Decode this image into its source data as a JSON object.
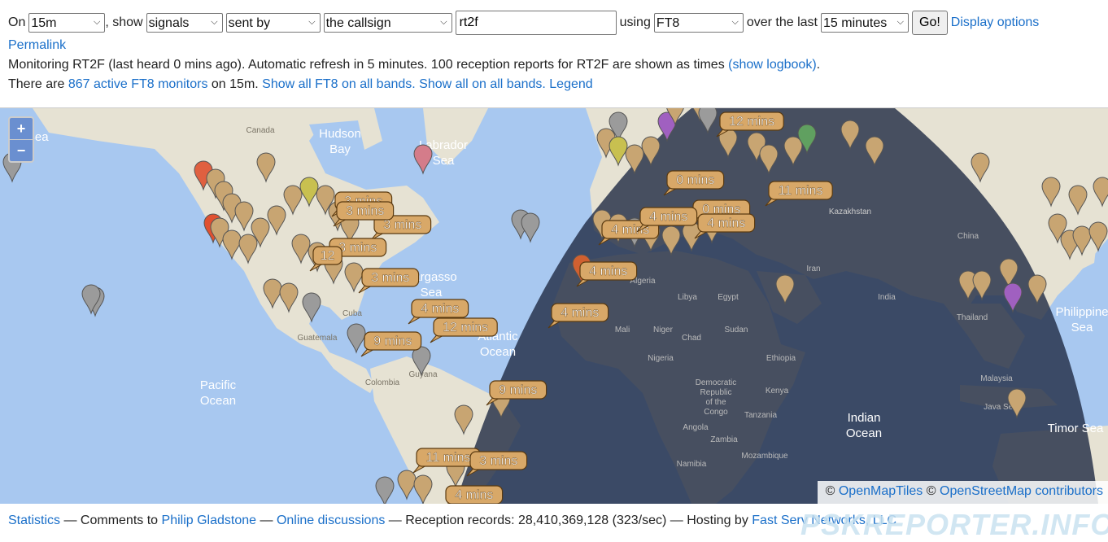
{
  "controls": {
    "on_label": "On",
    "band": "15m",
    "show_label": ", show",
    "what": "signals",
    "direction": "sent by",
    "target_type": "the callsign",
    "callsign": "rt2f",
    "using_label": "using",
    "mode": "FT8",
    "over_label": "over the last",
    "period": "15 minutes",
    "go_label": "Go!",
    "display_options": "Display options"
  },
  "permalink": "Permalink",
  "status_line": {
    "text": "Monitoring RT2F (last heard 0 mins ago). Automatic refresh in 5 minutes. 100 reception reports for RT2F are shown as times",
    "logbook_link": "(show logbook)",
    "after": "."
  },
  "monitors_line": {
    "prefix": "There are",
    "count_link": "867 active FT8 monitors",
    "middle": "on 15m.",
    "link_ft8_all": "Show all FT8 on all bands.",
    "link_all": "Show all on all bands.",
    "link_legend": "Legend"
  },
  "map": {
    "zoom_in": "+",
    "zoom_out": "−",
    "labels": {
      "hudson": "Hudson\nBay",
      "labrador": "Labrador\nSea",
      "canada": "Canada",
      "pacific": "Pacific\nOcean",
      "atlantic": "Atlantic\nOcean",
      "indian": "Indian\nOcean",
      "philippine": "Philippine\nSea",
      "timor": "Timor Sea",
      "sargasso": "Sargasso\nSea",
      "kazakhstan": "Kazakhstan",
      "bering": "g Sea",
      "cuba": "Cuba",
      "guatemala": "Guatemala",
      "colombia": "Colombia",
      "guyana": "Guyana",
      "libya": "Libya",
      "egypt": "Egypt",
      "mali": "Mali",
      "niger": "Niger",
      "chad": "Chad",
      "sudan": "Sudan",
      "nigeria": "Nigeria",
      "ethiopia": "Ethiopia",
      "kenya": "Kenya",
      "tanzania": "Tanzania",
      "angola": "Angola",
      "namibia": "Namibia",
      "zambia": "Zambia",
      "mozambique": "Mozambique",
      "algeria": "Algeria",
      "iran": "Iran",
      "china": "China",
      "india": "India",
      "thailand": "Thailand",
      "malaysia": "Malaysia",
      "java": "Java Sea",
      "congo": "Democratic\nRepublic\nof the\nCongo"
    },
    "time_tags": [
      "12 mins",
      "0 mins",
      "11 mins",
      "0 mins",
      "4 mins",
      "4 mins",
      "4 mins",
      "4 mins",
      "3 mins",
      "3 mins",
      "3 mins",
      "3 mins",
      "3 mins",
      "4 mins",
      "4 mins",
      "12 mins",
      "9 mins",
      "9 mins",
      "11 mins",
      "3 mins",
      "4 mins",
      "12"
    ],
    "attribution": {
      "copy1": "©",
      "link1": "OpenMapTiles",
      "copy2": "©",
      "link2": "OpenStreetMap contributors"
    }
  },
  "footer": {
    "statistics": "Statistics",
    "dash1": "— Comments to",
    "author": "Philip Gladstone",
    "dash2": "—",
    "discussions": "Online discussions",
    "records": "— Reception records: 28,410,369,128 (323/sec) — Hosting by",
    "hosting": "Fast Serv Networks, LLC",
    "watermark": "PSKREPORTER.INFO"
  },
  "colors": {
    "ocean": "#a8c8f0",
    "land": "#e6e2d3",
    "night": "#1f2b44",
    "tag_fill": "#d8a868",
    "pin_gray": "#9b9b9b",
    "pin_tan": "#c8a572",
    "link": "#1a6fc9"
  }
}
